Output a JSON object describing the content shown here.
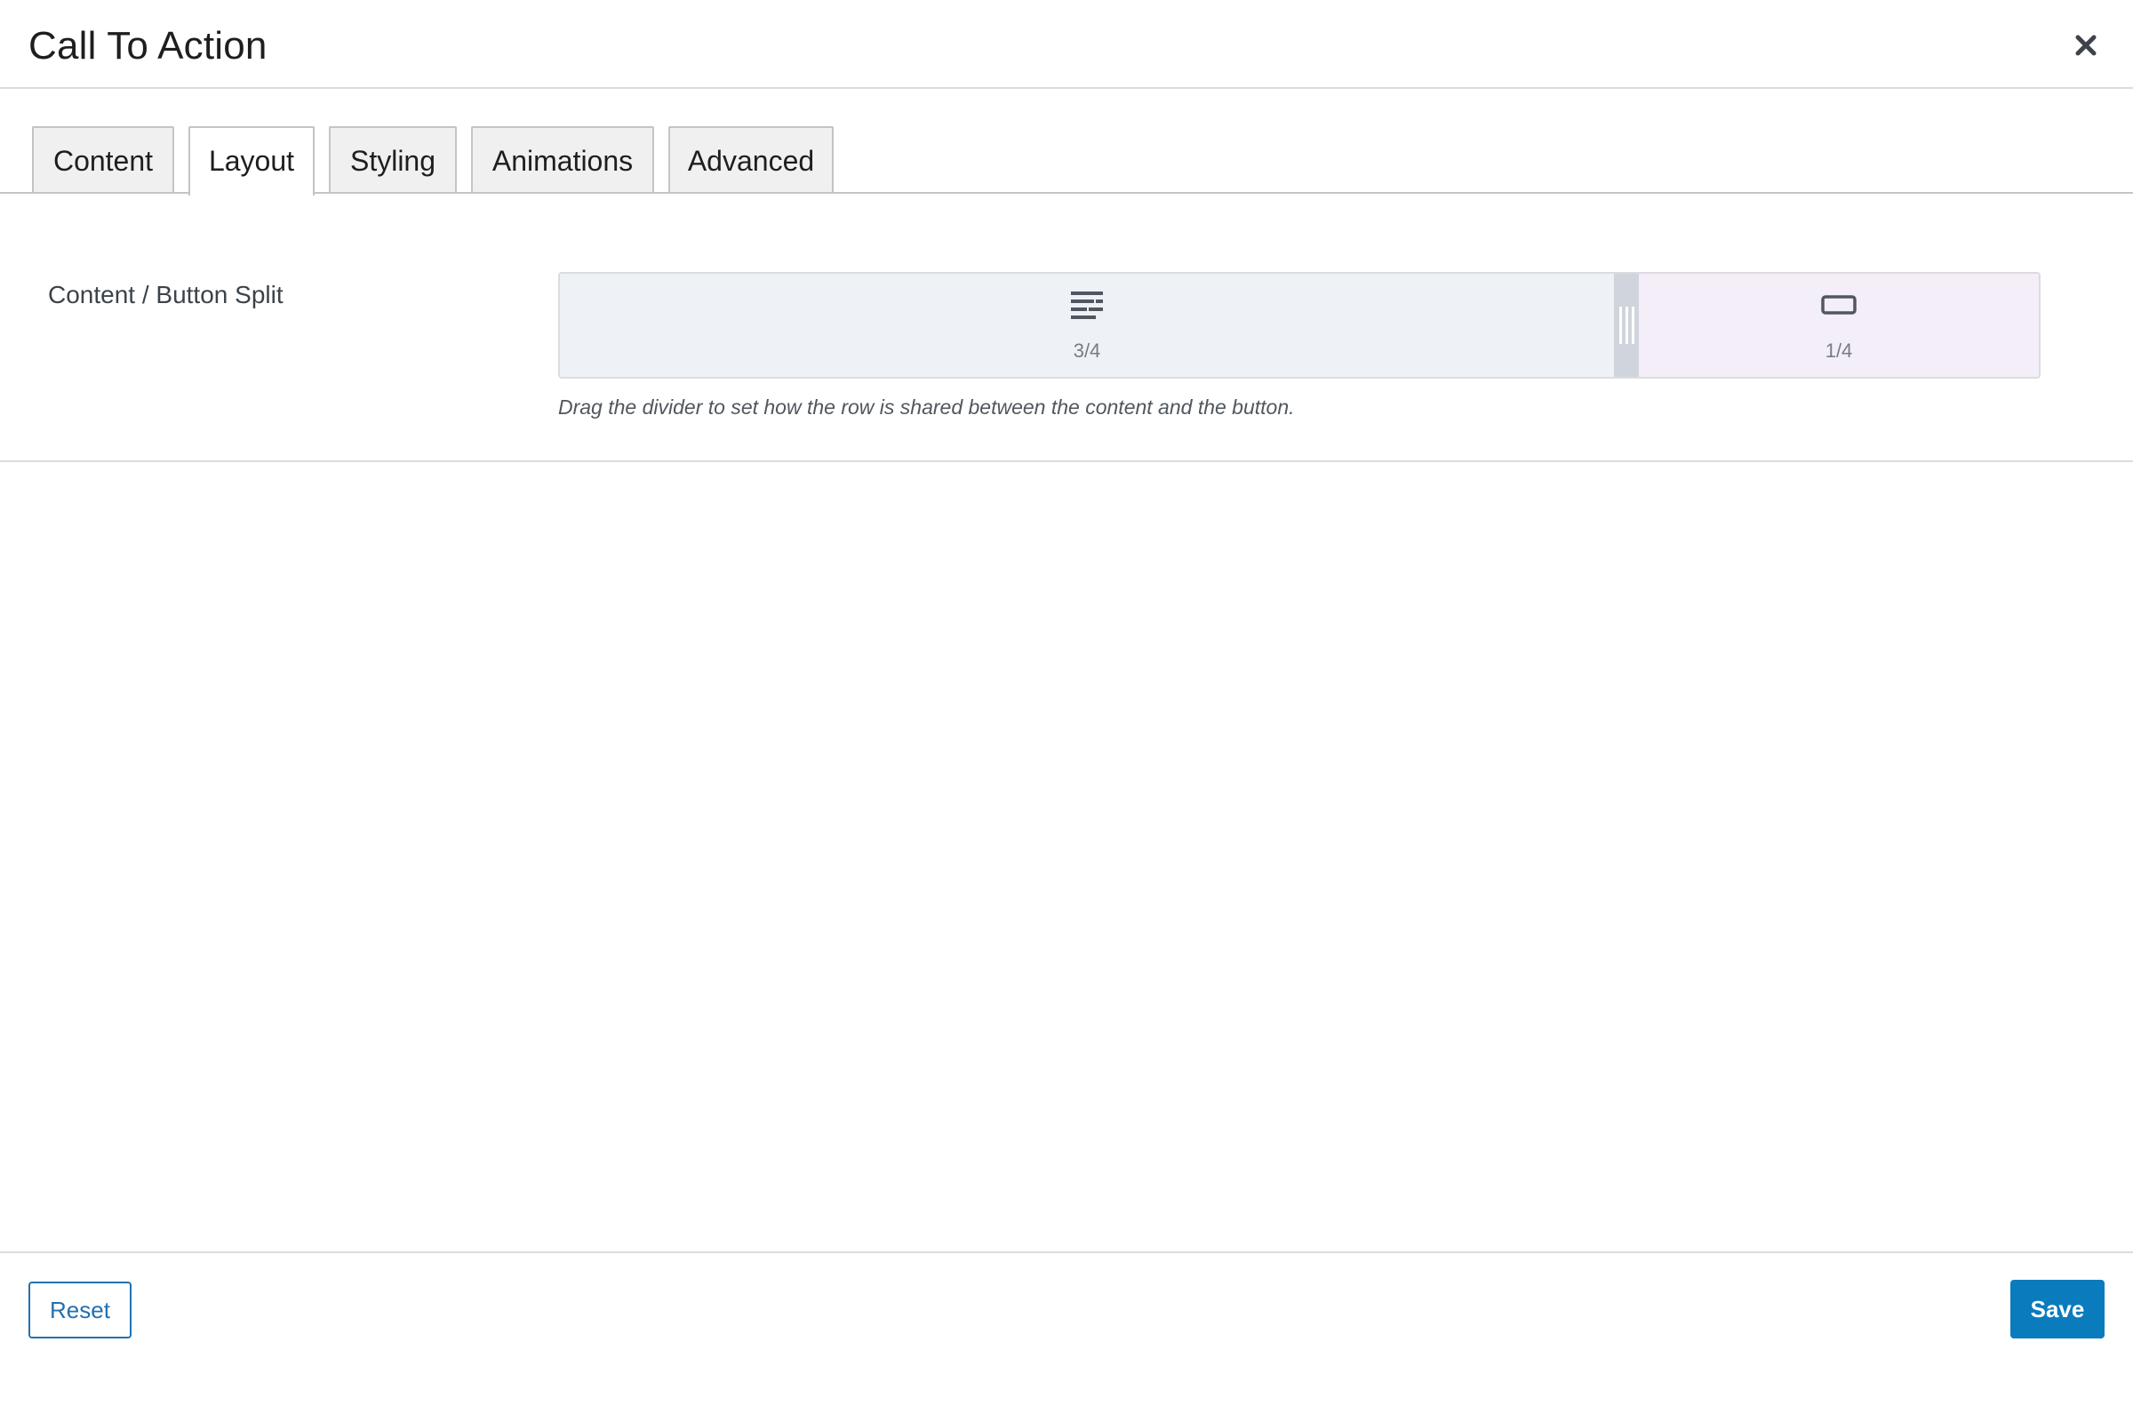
{
  "dialog": {
    "title": "Call To Action",
    "close_icon": "close-icon"
  },
  "tabs": [
    {
      "label": "Content",
      "active": false
    },
    {
      "label": "Layout",
      "active": true
    },
    {
      "label": "Styling",
      "active": false
    },
    {
      "label": "Animations",
      "active": false
    },
    {
      "label": "Advanced",
      "active": false
    }
  ],
  "layout": {
    "split_label": "Content / Button Split",
    "content_part": {
      "icon": "text-align-icon",
      "value": "3/4"
    },
    "button_part": {
      "icon": "button-icon",
      "value": "1/4"
    },
    "help_text": "Drag the divider to set how the row is shared between the content and the button."
  },
  "footer": {
    "reset_label": "Reset",
    "save_label": "Save"
  },
  "colors": {
    "accent": "#2271b1",
    "save_bg": "#0a7bbd",
    "content_part_bg": "#eef1f6",
    "button_part_bg": "#f3eef8"
  }
}
